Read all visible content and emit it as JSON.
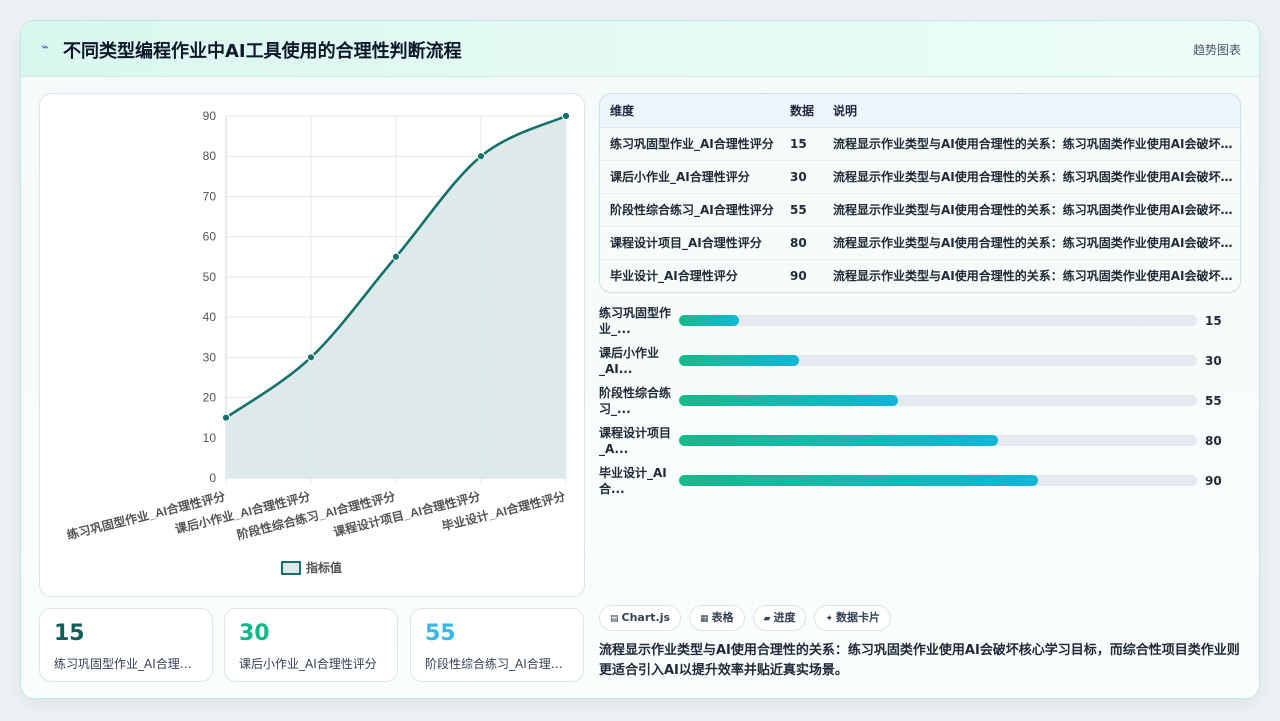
{
  "header": {
    "title": "不同类型编程作业中AI工具使用的合理性判断流程",
    "badge": "趋势图表"
  },
  "colors": {
    "line": "#16706b",
    "area": "#dbe9e8",
    "mini1": "#115e59",
    "mini2": "#14b88a",
    "mini3": "#38b6e8"
  },
  "chart_data": {
    "type": "line",
    "categories": [
      "练习巩固型作业_AI合理性评分",
      "课后小作业_AI合理性评分",
      "阶段性综合练习_AI合理性评分",
      "课程设计项目_AI合理性评分",
      "毕业设计_AI合理性评分"
    ],
    "series": [
      {
        "name": "指标值",
        "values": [
          15,
          30,
          55,
          80,
          90
        ]
      }
    ],
    "ylim": [
      0,
      90
    ],
    "yticks": [
      0,
      10,
      20,
      30,
      40,
      50,
      60,
      70,
      80,
      90
    ],
    "grid": true,
    "fill": true,
    "legend_position": "bottom"
  },
  "mini_cards": [
    {
      "value": "15",
      "label": "练习巩固型作业_AI合理性评分"
    },
    {
      "value": "30",
      "label": "课后小作业_AI合理性评分"
    },
    {
      "value": "55",
      "label": "阶段性综合练习_AI合理性评分"
    }
  ],
  "table": {
    "headers": [
      "维度",
      "数据",
      "说明"
    ],
    "rows": [
      [
        "练习巩固型作业_AI合理性评分",
        "15",
        "流程显示作业类型与AI使用合理性的关系：练习巩固类作业使用AI会破坏核心学习目标，而综合性项目类作业则更适合引入AI以提升效率并贴近真实场景。"
      ],
      [
        "课后小作业_AI合理性评分",
        "30",
        "流程显示作业类型与AI使用合理性的关系：练习巩固类作业使用AI会破坏核心学习目标，而综合性项目类作业则更适合引入AI以提升效率并贴近真实场景。"
      ],
      [
        "阶段性综合练习_AI合理性评分",
        "55",
        "流程显示作业类型与AI使用合理性的关系：练习巩固类作业使用AI会破坏核心学习目标，而综合性项目类作业则更适合引入AI以提升效率并贴近真实场景。"
      ],
      [
        "课程设计项目_AI合理性评分",
        "80",
        "流程显示作业类型与AI使用合理性的关系：练习巩固类作业使用AI会破坏核心学习目标，而综合性项目类作业则更适合引入AI以提升效率并贴近真实场景。"
      ],
      [
        "毕业设计_AI合理性评分",
        "90",
        "流程显示作业类型与AI使用合理性的关系：练习巩固类作业使用AI会破坏核心学习目标，而综合性项目类作业则更适合引入AI以提升效率并贴近真实场景。"
      ]
    ]
  },
  "progress": {
    "max": 130,
    "items": [
      {
        "label": "练习巩固型作业_...",
        "value": 15
      },
      {
        "label": "课后小作业_AI...",
        "value": 30
      },
      {
        "label": "阶段性综合练习_...",
        "value": 55
      },
      {
        "label": "课程设计项目_A...",
        "value": 80
      },
      {
        "label": "毕业设计_AI合...",
        "value": 90
      }
    ]
  },
  "tags": [
    {
      "icon": "chart-icon",
      "glyph": "▤",
      "label": "Chart.js"
    },
    {
      "icon": "table-icon",
      "glyph": "▦",
      "label": "表格"
    },
    {
      "icon": "progress-icon",
      "glyph": "▰",
      "label": "进度"
    },
    {
      "icon": "card-icon",
      "glyph": "✦",
      "label": "数据卡片"
    }
  ],
  "description": "流程显示作业类型与AI使用合理性的关系：练习巩固类作业使用AI会破坏核心学习目标，而综合性项目类作业则更适合引入AI以提升效率并贴近真实场景。"
}
